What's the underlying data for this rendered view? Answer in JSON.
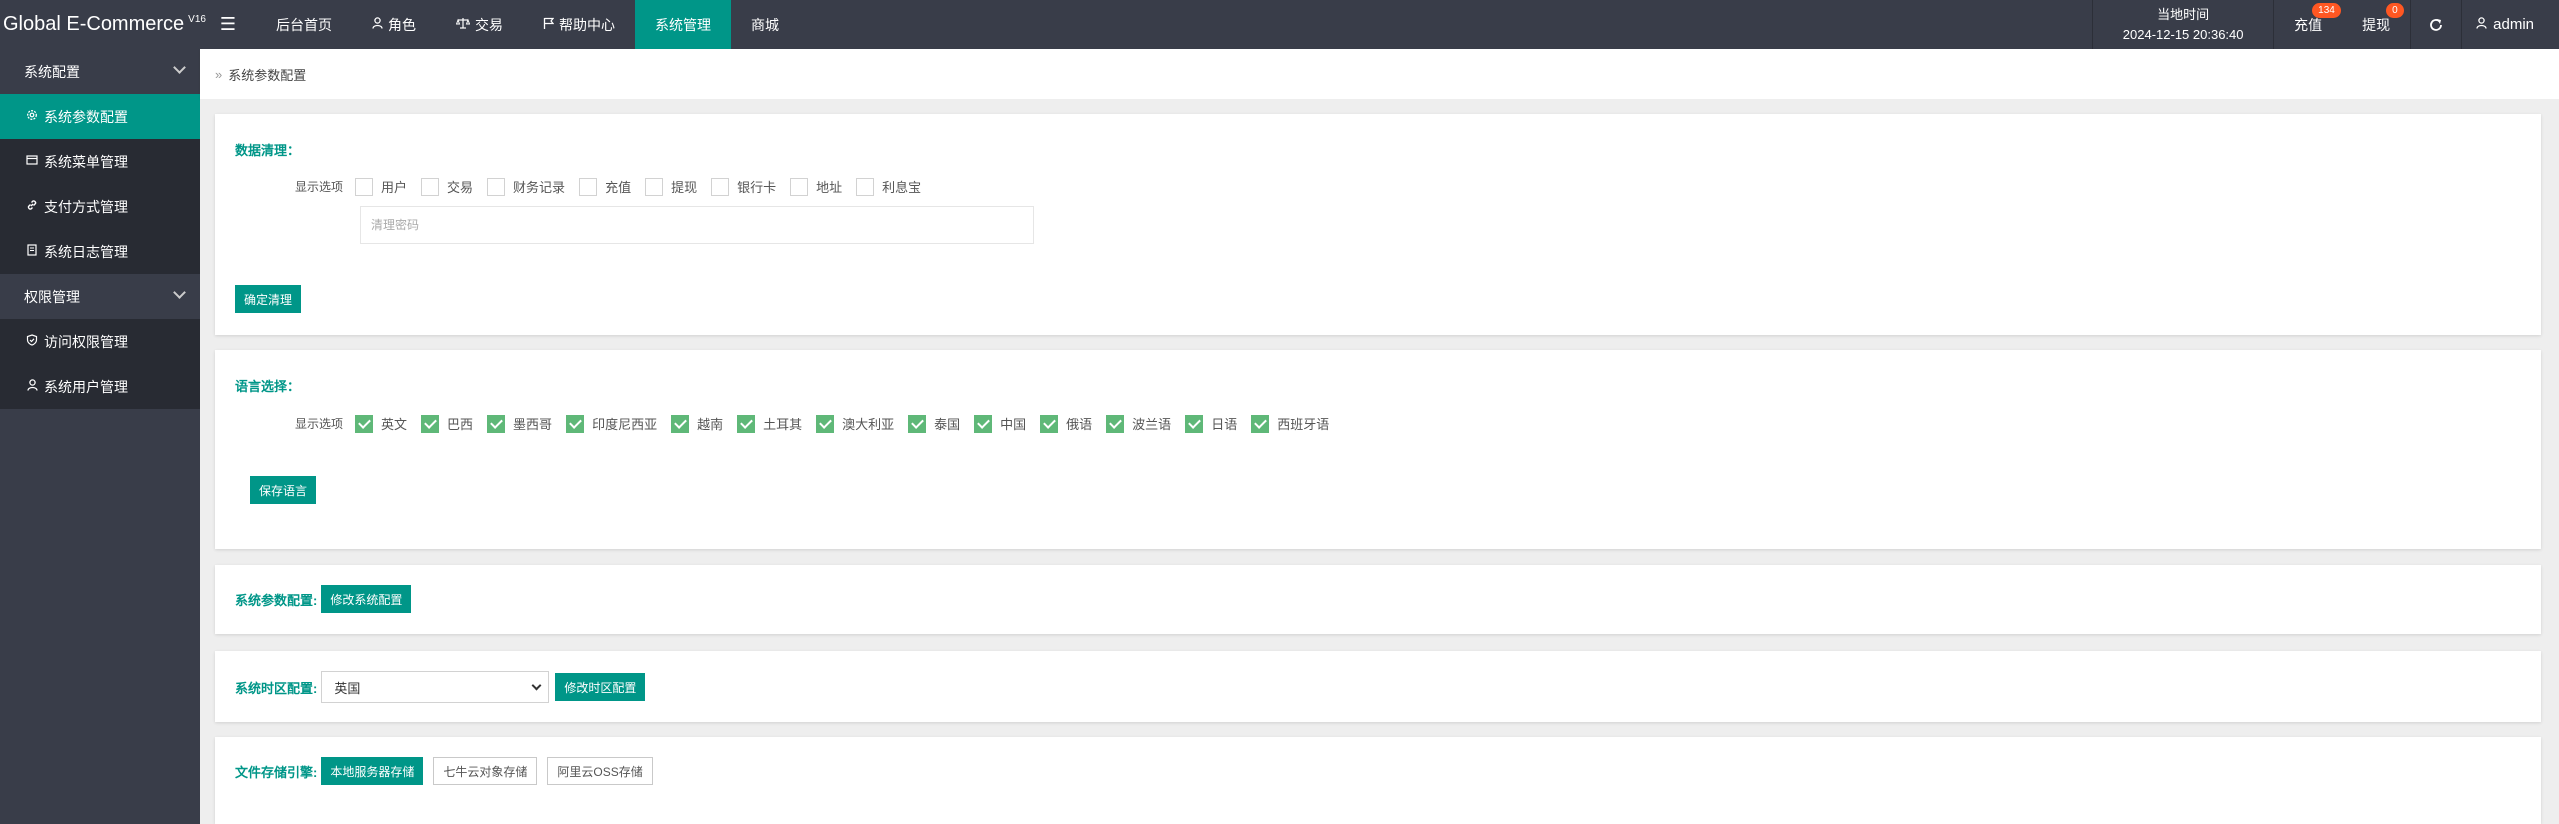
{
  "app": {
    "brand": "Global E-Commerce",
    "version": "V16"
  },
  "topnav": {
    "items": [
      {
        "label": "后台首页",
        "icon": "home"
      },
      {
        "label": "角色",
        "icon": "user-icon"
      },
      {
        "label": "交易",
        "icon": "scale-icon"
      },
      {
        "label": "帮助中心",
        "icon": "flag-icon"
      },
      {
        "label": "系统管理",
        "icon": "",
        "active": true
      },
      {
        "label": "商城",
        "icon": ""
      }
    ],
    "clock_label": "当地时间",
    "clock_value": "2024-12-15 20:36:40",
    "recharge_label": "充值",
    "recharge_badge": "134",
    "withdraw_label": "提现",
    "withdraw_badge": "0",
    "refresh_icon": "refresh-icon",
    "user": "admin"
  },
  "sidebar": {
    "group1": "系统配置",
    "items1": [
      {
        "label": "系统参数配置",
        "icon": "gear-icon",
        "active": true
      },
      {
        "label": "系统菜单管理",
        "icon": "window-icon"
      },
      {
        "label": "支付方式管理",
        "icon": "link-icon"
      },
      {
        "label": "系统日志管理",
        "icon": "document-icon"
      }
    ],
    "group2": "权限管理",
    "items2": [
      {
        "label": "访问权限管理",
        "icon": "shield-icon"
      },
      {
        "label": "系统用户管理",
        "icon": "user-icon"
      }
    ]
  },
  "breadcrumb": "系统参数配置",
  "data_cleanup": {
    "title": "数据清理：",
    "row_label": "显示选项",
    "options": [
      {
        "label": "用户",
        "checked": false
      },
      {
        "label": "交易",
        "checked": false
      },
      {
        "label": "财务记录",
        "checked": false
      },
      {
        "label": "充值",
        "checked": false
      },
      {
        "label": "提现",
        "checked": false
      },
      {
        "label": "银行卡",
        "checked": false
      },
      {
        "label": "地址",
        "checked": false
      },
      {
        "label": "利息宝",
        "checked": false
      }
    ],
    "password_placeholder": "清理密码",
    "confirm_button": "确定清理"
  },
  "language": {
    "title": "语言选择：",
    "row_label": "显示选项",
    "options": [
      {
        "label": "英文",
        "checked": true
      },
      {
        "label": "巴西",
        "checked": true
      },
      {
        "label": "墨西哥",
        "checked": true
      },
      {
        "label": "印度尼西亚",
        "checked": true
      },
      {
        "label": "越南",
        "checked": true
      },
      {
        "label": "土耳其",
        "checked": true
      },
      {
        "label": "澳大利亚",
        "checked": true
      },
      {
        "label": "泰国",
        "checked": true
      },
      {
        "label": "中国",
        "checked": true
      },
      {
        "label": "俄语",
        "checked": true
      },
      {
        "label": "波兰语",
        "checked": true
      },
      {
        "label": "日语",
        "checked": true
      },
      {
        "label": "西班牙语",
        "checked": true
      }
    ],
    "save_button": "保存语言"
  },
  "system_params": {
    "label": "系统参数配置:",
    "button": "修改系统配置"
  },
  "timezone": {
    "label": "系统时区配置:",
    "selected": "英国",
    "button": "修改时区配置"
  },
  "storage": {
    "label": "文件存储引擎:",
    "options": [
      {
        "label": "本地服务器存储",
        "active": true
      },
      {
        "label": "七牛云对象存储",
        "active": false
      },
      {
        "label": "阿里云OSS存储",
        "active": false
      }
    ]
  },
  "colors": {
    "accent": "#009688",
    "checkbox_checked": "#5fb878",
    "dark_bg": "#393d49",
    "badge": "#ff5722"
  }
}
